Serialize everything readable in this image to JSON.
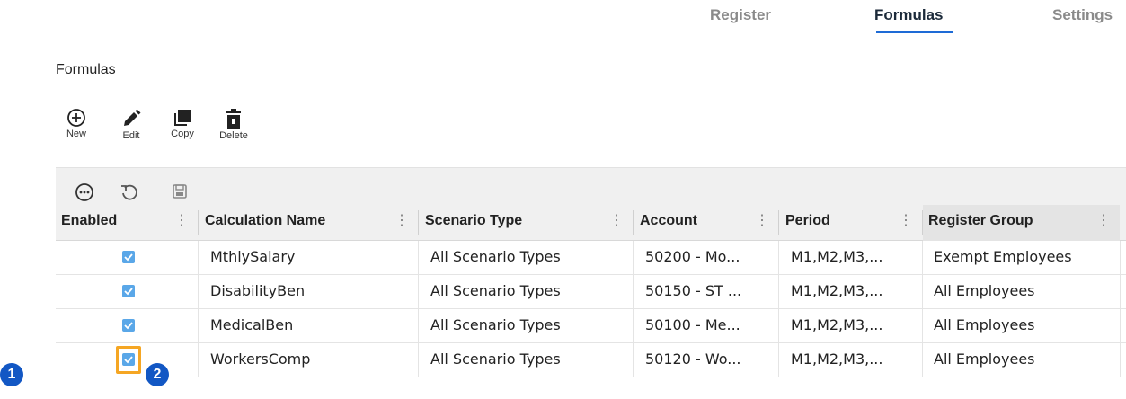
{
  "tabs": {
    "register": "Register",
    "formulas": "Formulas",
    "settings": "Settings",
    "active": "Formulas"
  },
  "page_title": "Formulas",
  "toolbar": {
    "new": "New",
    "edit": "Edit",
    "copy": "Copy",
    "delete": "Delete"
  },
  "grid_toolbar_icons": [
    "more-options-icon",
    "undo-icon",
    "save-icon"
  ],
  "columns": [
    "Enabled",
    "Calculation Name",
    "Scenario Type",
    "Account",
    "Period",
    "Register Group"
  ],
  "rows": [
    {
      "enabled": true,
      "calculation_name": "MthlySalary",
      "scenario_type": "All Scenario Types",
      "account": "50200 - Mo...",
      "period": "M1,M2,M3,...",
      "register_group": "Exempt Employees"
    },
    {
      "enabled": true,
      "calculation_name": "DisabilityBen",
      "scenario_type": "All Scenario Types",
      "account": "50150 - ST ...",
      "period": "M1,M2,M3,...",
      "register_group": "All Employees"
    },
    {
      "enabled": true,
      "calculation_name": "MedicalBen",
      "scenario_type": "All Scenario Types",
      "account": "50100 - Me...",
      "period": "M1,M2,M3,...",
      "register_group": "All Employees"
    },
    {
      "enabled": true,
      "calculation_name": "WorkersComp",
      "scenario_type": "All Scenario Types",
      "account": "50120 - Wo...",
      "period": "M1,M2,M3,...",
      "register_group": "All Employees"
    }
  ],
  "callouts": [
    "1",
    "2"
  ],
  "colors": {
    "accent": "#1e6bd6",
    "checkbox": "#5aa7e8",
    "highlight": "#f5a623",
    "callout": "#1257c4"
  }
}
